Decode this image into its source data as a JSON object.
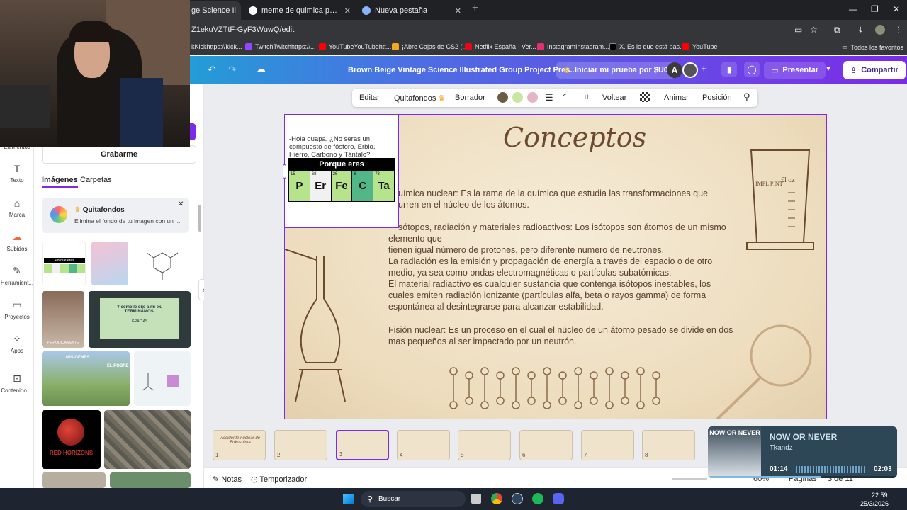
{
  "browser": {
    "tabs": [
      {
        "label": "ge Science Il"
      },
      {
        "label": "meme de quimica para termina"
      },
      {
        "label": "Nueva pestaña"
      }
    ],
    "url": "Z1ekuVZTtF-GyF3WuwQ/edit",
    "bookmarks": [
      {
        "label": "kKickhttps://kick...",
        "color": "#53fc18"
      },
      {
        "label": "TwitchTwitchhttps://...",
        "color": "#9146ff"
      },
      {
        "label": "YouTubeYouTubehtt...",
        "color": "#ff0000"
      },
      {
        "label": "¡Abre Cajas de CS2 (...",
        "color": "#f5a623"
      },
      {
        "label": "Netflix España - Ver...",
        "color": "#e50914"
      },
      {
        "label": "InstagramInstagram...",
        "color": "#e1306c"
      },
      {
        "label": "X. Es lo que está pas...",
        "color": "#000000"
      },
      {
        "label": "YouTube",
        "color": "#ff0000"
      }
    ],
    "all_favorites": "Todos los favoritos"
  },
  "canva": {
    "title": "Brown Beige Vintage Science Illustrated Group Project Pres...",
    "trial_button": "Iniciar mi prueba por $U0",
    "avatar_letter": "A",
    "present_button": "Presentar",
    "share_button": "Compartir",
    "brand_color": "#7d2ae8"
  },
  "rail": [
    {
      "label": "Elementos",
      "icon": "elements-icon"
    },
    {
      "label": "Texto",
      "icon": "text-icon",
      "glyph": "T"
    },
    {
      "label": "Marca",
      "icon": "brand-icon",
      "glyph": "⌂"
    },
    {
      "label": "Subidos",
      "icon": "uploads-icon",
      "glyph": "☁"
    },
    {
      "label": "Herramient...",
      "icon": "tools-icon",
      "glyph": "✎"
    },
    {
      "label": "Proyectos",
      "icon": "projects-icon",
      "glyph": "▭"
    },
    {
      "label": "Apps",
      "icon": "apps-icon",
      "glyph": "⁘"
    },
    {
      "label": "Contenido ...",
      "icon": "content-icon",
      "glyph": "⊡"
    }
  ],
  "panel": {
    "record_button": "Grabarme",
    "tabs": [
      "Imágenes",
      "Carpetas"
    ],
    "promo_title": "Quitafondos",
    "promo_text": "Elimina el fondo de tu imagen con un ...",
    "thumb_texts": {
      "meme2_caption": "Y como le dije a mi ex, TERMINAMOS.",
      "meme2_sub": "GRACIAS",
      "meme_periodic": "PERIODICAMENTE",
      "red_horizons": "RED HORIZONS",
      "meme_sheep_top": "MIS GENES",
      "meme_sheep_right": "EL POBRE",
      "meme_porque_eres": "Porque eres"
    }
  },
  "toolbar": {
    "edit": "Editar",
    "bg_remover": "Quitafondos",
    "eraser": "Borrador",
    "flip": "Voltear",
    "animate": "Animar",
    "position": "Posición",
    "swatches": [
      "#6b5a44",
      "#c8e6a0",
      "#e4b5c4"
    ]
  },
  "slide": {
    "heading": "Conceptos",
    "meme_question": "-Hola guapa, ¿No seras un compuesto de fósforo, Erbio, Hierro, Carbono y Tántalo?",
    "meme_banner": "Porque eres",
    "meme_elements": [
      {
        "num": "15",
        "sym": "P",
        "color": "#b5e48c"
      },
      {
        "num": "68",
        "sym": "Er",
        "color": "#f1f1f1"
      },
      {
        "num": "26",
        "sym": "Fe",
        "color": "#b5e48c"
      },
      {
        "num": "6",
        "sym": "C",
        "color": "#52b788"
      },
      {
        "num": "73",
        "sym": "Ta",
        "color": "#b5e48c"
      }
    ],
    "paragraphs": [
      "uímica nuclear: Es la rama de la química que estudia las transformaciones que",
      "urren en el núcleo de los átomos.",
      "sótopos, radiación y materiales radioactivos: Los isótopos son átomos de un mismo",
      "elemento que",
      "tienen igual número de protones, pero diferente numero de neutrones.",
      "La radiación es la emisión y propagación de energía a través del espacio o de otro",
      "medio, ya sea como ondas electromagnéticas o partículas subatómicas.",
      "El material radiactivo es cualquier sustancia que contenga isótopos inestables, los",
      "cuales emiten radiación ionizante (partículas alfa, beta o rayos gamma) de forma",
      "espontánea al desintegrarse para alcanzar estabilidad.",
      "Fisión nuclear: Es un proceso en el cual el núcleo de un átomo pesado se divide en dos",
      "mas pequeños al ser impactado por un neutrón."
    ],
    "beaker_label": "IMPL PINT",
    "beaker_oz": "£l oz"
  },
  "strip": {
    "pages": [
      "1",
      "2",
      "3",
      "4",
      "5",
      "6",
      "7",
      "8"
    ],
    "first_title": "Accidente nuclear de Fukushima"
  },
  "bottom": {
    "notes": "Notas",
    "timer": "Temporizador",
    "zoom": "60%",
    "pages_label": "Páginas",
    "page_count": "3 de 11"
  },
  "music": {
    "song": "NOW OR NEVER",
    "artist": "Tkandz",
    "cover_text": "NOW OR NEVER",
    "elapsed": "01:14",
    "total": "02:03",
    "progress": 0.6
  },
  "taskbar": {
    "search": "Buscar",
    "time": "22:59",
    "date": "25/3/2026"
  }
}
